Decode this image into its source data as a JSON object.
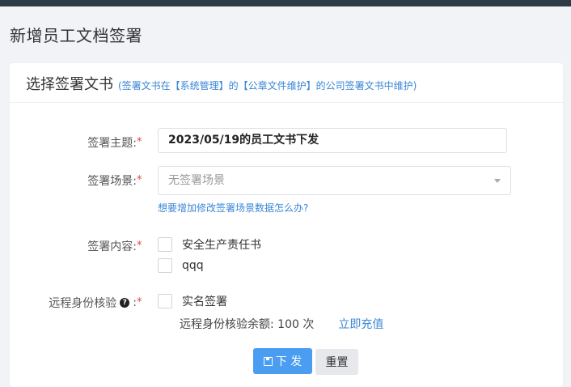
{
  "page": {
    "title": "新增员工文档签署"
  },
  "section": {
    "title": "选择签署文书",
    "note": "(签署文书在【系统管理】的【公章文件维护】的公司签署文书中维护)"
  },
  "form": {
    "subject_label": "签署主题:",
    "subject_value": "2023/05/19的员工文书下发",
    "scene_label": "签署场景:",
    "scene_placeholder": "无签署场景",
    "scene_help": "想要增加修改签署场景数据怎么办?",
    "content_label": "签署内容:",
    "content_options": [
      "安全生产责任书",
      "qqq"
    ],
    "verify_label": "远程身份核验",
    "verify_colon": ":",
    "verify_option": "实名签署",
    "balance_text": "远程身份核验余额: 100 次",
    "recharge_link": "立即充值",
    "required_mark": "*"
  },
  "actions": {
    "submit_label": "下 发",
    "reset_label": "重置"
  },
  "colors": {
    "primary": "#4a9df0",
    "link": "#3a86d6",
    "required": "#e24a4a"
  }
}
